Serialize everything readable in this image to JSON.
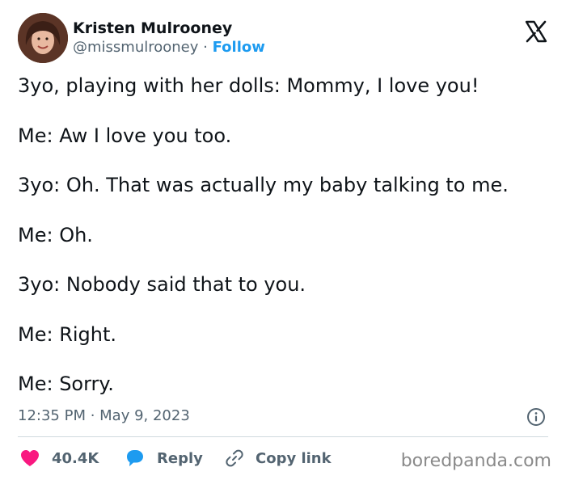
{
  "author": {
    "display_name": "Kristen Mulrooney",
    "handle": "@missmulrooney",
    "separator": "·",
    "follow_label": "Follow"
  },
  "post": {
    "paragraphs": [
      "3yo, playing with her dolls: Mommy, I love you!",
      "Me: Aw I love you too.",
      "3yo: Oh. That was actually my baby talking to me.",
      "Me: Oh.",
      "3yo: Nobody said that to you.",
      "Me: Right.",
      "Me: Sorry."
    ],
    "timestamp": "12:35 PM · May 9, 2023"
  },
  "actions": {
    "likes": "40.4K",
    "reply_label": "Reply",
    "copy_label": "Copy link"
  },
  "watermark": "boredpanda.com",
  "icons": {
    "logo": "x-logo-icon",
    "info": "info-icon",
    "like": "heart-icon",
    "reply": "speech-bubble-icon",
    "copy": "link-icon"
  },
  "colors": {
    "accent": "#1d9bf0",
    "like": "#f91880",
    "muted": "#536471",
    "text": "#0f1419"
  }
}
